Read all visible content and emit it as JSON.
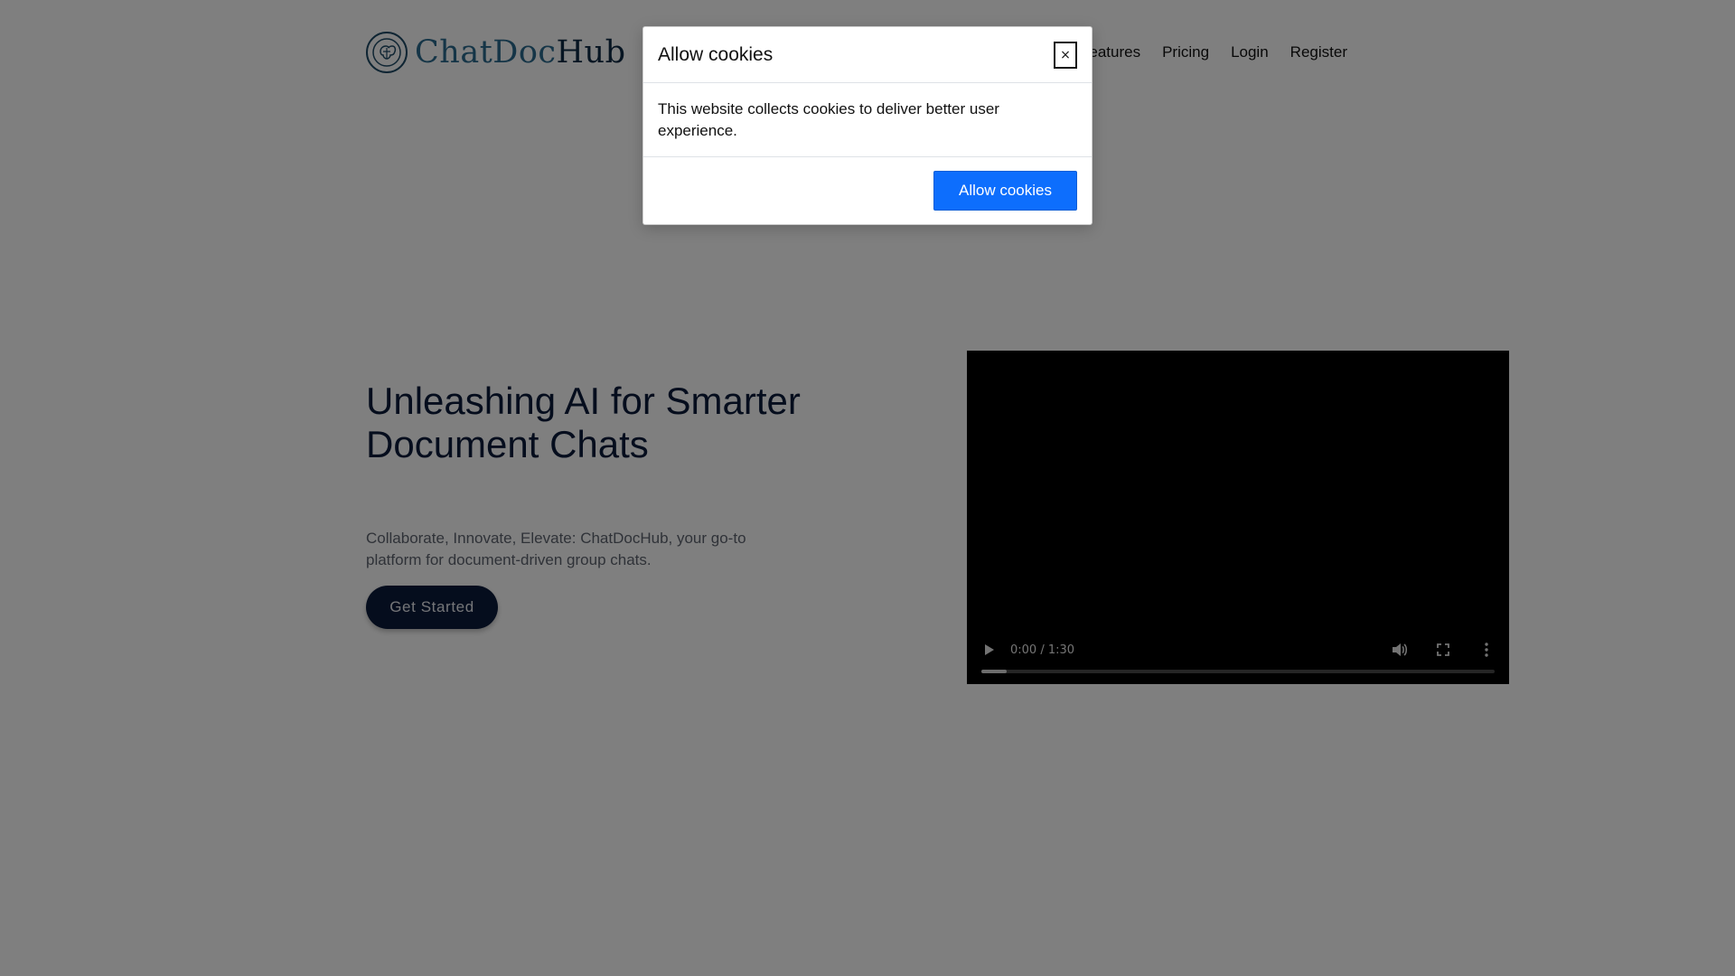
{
  "brand": {
    "name_part1": "ChatDoc",
    "name_part2": "Hub",
    "logo_icon": "brain-icon"
  },
  "nav": {
    "items": [
      {
        "label": "Features"
      },
      {
        "label": "Pricing"
      },
      {
        "label": "Login"
      },
      {
        "label": "Register"
      }
    ]
  },
  "hero": {
    "title": "Unleashing AI for Smarter Document Chats",
    "subtitle": "Collaborate, Innovate, Elevate: ChatDocHub, your go-to platform for document-driven group chats.",
    "cta_label": "Get Started"
  },
  "video": {
    "time": "0:00 / 1:30",
    "progress_fraction": 0.05,
    "icons": [
      "play-icon",
      "volume-icon",
      "fullscreen-icon",
      "more-options-icon"
    ]
  },
  "cookie_modal": {
    "title": "Allow cookies",
    "close_label": "×",
    "message": "This website collects cookies to deliver better user experience.",
    "button_label": "Allow cookies"
  },
  "colors": {
    "primary_button": "#0d6efd",
    "cta_background": "#0b1a3a",
    "brand_accent": "#2b6a8e",
    "overlay": "rgba(0,0,0,0.5)"
  }
}
